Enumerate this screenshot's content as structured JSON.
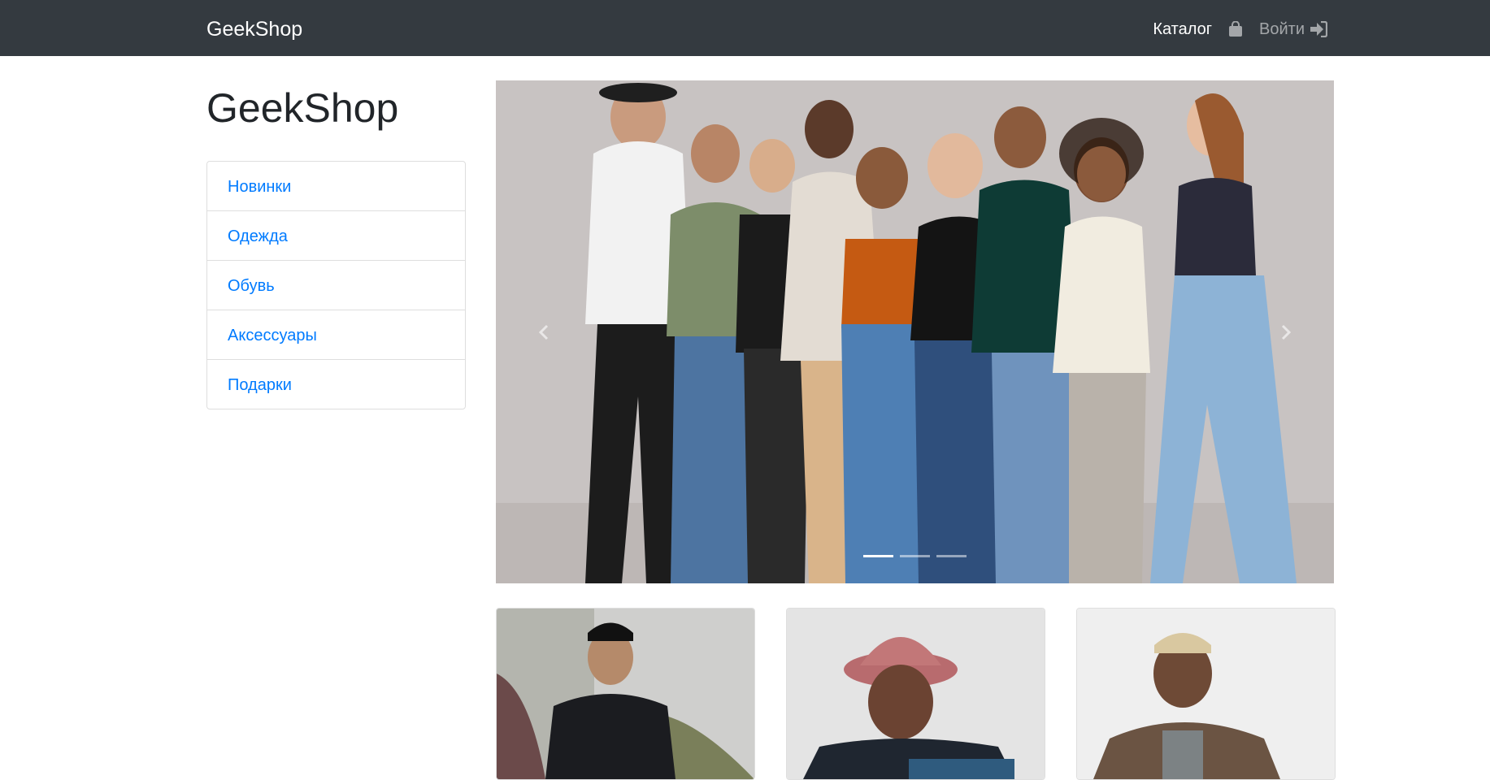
{
  "navbar": {
    "brand": "GeekShop",
    "catalog_label": "Каталог",
    "bag_icon": "shopping-bag-icon",
    "login_label": "Войти",
    "login_icon": "sign-in-icon",
    "background": "#343a40"
  },
  "sidebar": {
    "title": "GeekShop",
    "categories": [
      {
        "label": "Новинки"
      },
      {
        "label": "Одежда"
      },
      {
        "label": "Обувь"
      },
      {
        "label": "Аксессуары"
      },
      {
        "label": "Подарки"
      }
    ],
    "link_color": "#007bff"
  },
  "carousel": {
    "slides_count": 3,
    "active_index": 0,
    "prev_icon": "chevron-left-icon",
    "next_icon": "chevron-right-icon"
  },
  "products": [
    {
      "image": "product-photo-black-hoodie"
    },
    {
      "image": "product-photo-bucket-hat-jacket"
    },
    {
      "image": "product-photo-brown-fleece"
    }
  ]
}
